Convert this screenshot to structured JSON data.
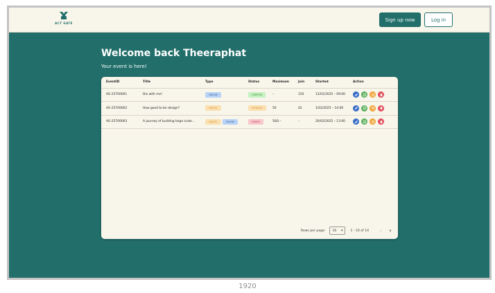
{
  "header": {
    "logo_text": "ACT GATE",
    "signup_label": "Sign up now",
    "login_label": "Log in"
  },
  "main": {
    "welcome": "Welcome back Theeraphat",
    "subtitle": "Your event is here!"
  },
  "table": {
    "columns": [
      "EventID",
      "Title",
      "Type",
      "Status",
      "Maximum",
      "Join",
      "Started",
      "Action"
    ],
    "rows": [
      {
        "id": "AG-25700001",
        "title": "Die with me!",
        "types": [
          "ONLINE"
        ],
        "status": "STARTED",
        "maximum": "–",
        "join": "150",
        "started": "12/01/2025 – 09:00"
      },
      {
        "id": "AG-25700002",
        "title": "How good to be design?",
        "types": [
          "ONSITE"
        ],
        "status": "PENDING",
        "maximum": "50",
        "join": "42",
        "started": "1/02/2025 – 14:00"
      },
      {
        "id": "AG-25700003",
        "title": "A journey of building large scale...",
        "types": [
          "ONSITE",
          "ONLINE"
        ],
        "status": "ENDED",
        "maximum": "50Ω –",
        "join": "–",
        "started": "20/02/2025 – 13:00"
      }
    ]
  },
  "pagination": {
    "rows_per_page_label": "Rows per page:",
    "rows_per_page_value": "10",
    "range": "1 - 10 of 14"
  },
  "caption": "1920",
  "colors": {
    "brand": "#216e6a",
    "background": "#f8f5ea"
  }
}
